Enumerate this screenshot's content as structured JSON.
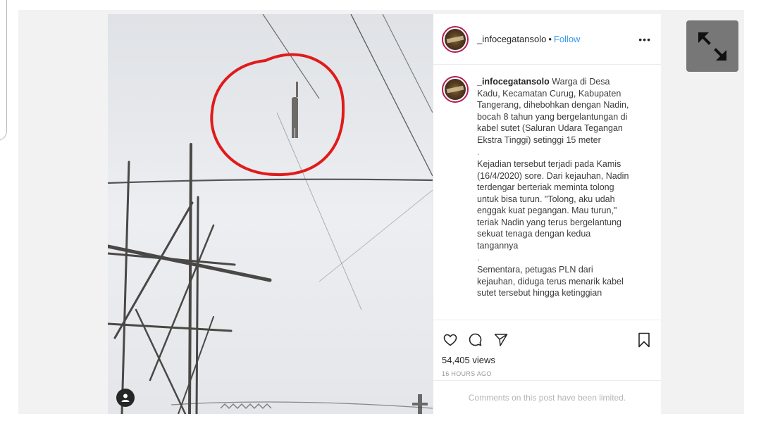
{
  "header": {
    "username": "_infocegatansolo",
    "separator": "•",
    "follow_label": "Follow",
    "more_label": "•••"
  },
  "caption": {
    "username": "_infocegatansolo",
    "paragraph1": "Warga di Desa Kadu, Kecamatan Curug, Kabupaten Tangerang, dihebohkan dengan Nadin, bocah 8 tahun yang bergelantungan di kabel sutet (Saluran Udara Tegangan Ekstra Tinggi) setinggi 15 meter",
    "sep1": ".",
    "paragraph2": "Kejadian tersebut terjadi pada Kamis (16/4/2020) sore. Dari kejauhan, Nadin terdengar berteriak meminta tolong untuk bisa turun. \"Tolong, aku udah enggak kuat pegangan. Mau turun,\" teriak Nadin yang terus bergelantung sekuat tenaga dengan kedua tangannya",
    "sep2": ".",
    "paragraph3": "Sementara, petugas PLN dari kejauhan, diduga terus menarik kabel sutet tersebut hingga ketinggian"
  },
  "stats": {
    "views": "54,405 views",
    "time_ago": "16 HOURS AGO"
  },
  "comments_note": "Comments on this post have been limited.",
  "icons": {
    "like": "heart-icon",
    "comment": "comment-icon",
    "share": "send-icon",
    "save": "bookmark-icon",
    "expand": "expand-icon",
    "user_tag": "user-icon"
  },
  "colors": {
    "follow": "#3897f0",
    "annotation_circle": "#e01b1b",
    "expand_button": "#777777"
  }
}
